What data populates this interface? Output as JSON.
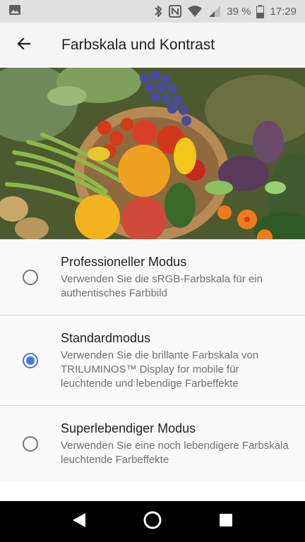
{
  "status_bar": {
    "battery_percent": "39 %",
    "time": "17:29",
    "icons": [
      "image-icon",
      "bluetooth-icon",
      "nfc-icon",
      "wifi-icon",
      "signal-icon",
      "battery-icon"
    ]
  },
  "header": {
    "title": "Farbskala und Kontrast",
    "back_icon": "back-arrow-icon"
  },
  "hero": {
    "image": "vegetables-photo"
  },
  "options": [
    {
      "title": "Professioneller Modus",
      "description": "Verwenden Sie die sRGB-Farbskala für ein authentisches Farbbild",
      "selected": false
    },
    {
      "title": "Standardmodus",
      "description": "Verwenden Sie die brillante Farbskala von TRILUMINOS™ Display for mobile für leuchtende und lebendige Farbeffekte",
      "selected": true
    },
    {
      "title": "Superlebendiger Modus",
      "description": "Verwenden Sie eine noch lebendigere Farbskala leuchtende Farbeffekte",
      "selected": false
    }
  ],
  "nav_bar": {
    "icons": [
      "nav-back-icon",
      "nav-home-icon",
      "nav-recents-icon"
    ]
  },
  "colors": {
    "accent": "#4a78d4",
    "app_bar": "#f5f5f5",
    "status_bar": "#e0e0e0",
    "nav_bar": "#000000"
  }
}
